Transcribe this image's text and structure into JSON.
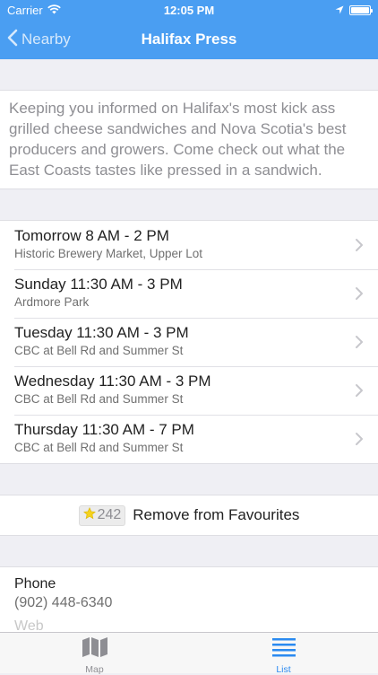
{
  "status_bar": {
    "carrier": "Carrier",
    "time": "12:05 PM"
  },
  "nav": {
    "back_label": "Nearby",
    "title": "Halifax Press"
  },
  "description": "Keeping you informed on Halifax's most kick ass grilled cheese sandwiches and Nova Scotia's best producers and growers. Come check out what the East Coasts tastes like pressed in a sandwich.",
  "schedule": [
    {
      "time": "Tomorrow 8 AM - 2 PM",
      "location": "Historic Brewery Market, Upper Lot"
    },
    {
      "time": "Sunday 11:30 AM - 3 PM",
      "location": "Ardmore Park"
    },
    {
      "time": "Tuesday 11:30 AM - 3 PM",
      "location": "CBC at Bell Rd and Summer St"
    },
    {
      "time": "Wednesday 11:30 AM - 3 PM",
      "location": "CBC at Bell Rd and Summer St"
    },
    {
      "time": "Thursday 11:30 AM - 7 PM",
      "location": "CBC at Bell Rd and Summer St"
    }
  ],
  "favourites": {
    "count": "242",
    "label": "Remove from Favourites"
  },
  "contact": {
    "phone_label": "Phone",
    "phone_value": "(902) 448-6340",
    "next_label": "Web"
  },
  "tabs": [
    {
      "label": "Map",
      "color": "#8e8e93"
    },
    {
      "label": "List",
      "color": "#2b8af0"
    }
  ],
  "colors": {
    "header": "#4a9ef2",
    "accent": "#2b8af0",
    "star": "#f5d21c"
  }
}
